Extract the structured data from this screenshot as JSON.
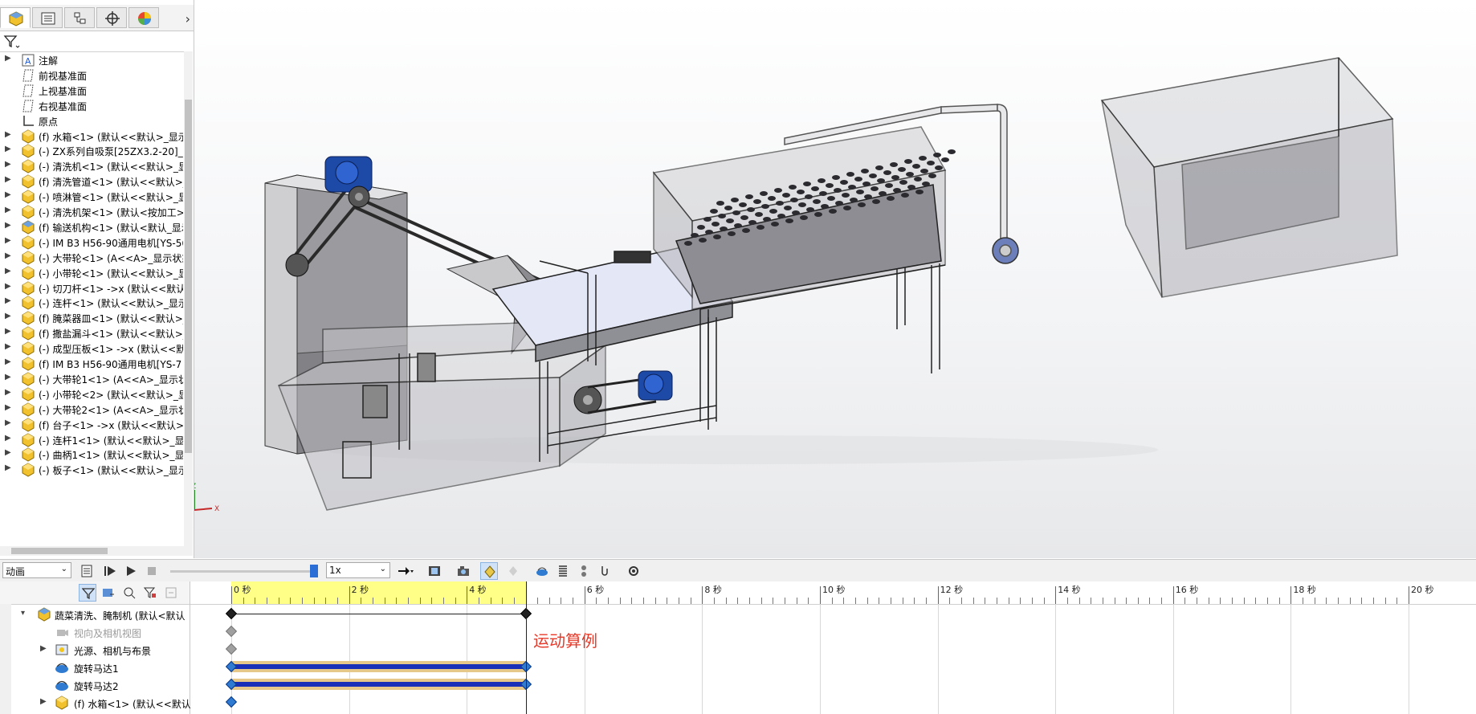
{
  "feature_tree": {
    "items": [
      {
        "label": "注解",
        "icon": "annotation-icon",
        "expandable": true
      },
      {
        "label": "前视基准面",
        "icon": "plane-icon",
        "expandable": false
      },
      {
        "label": "上视基准面",
        "icon": "plane-icon",
        "expandable": false
      },
      {
        "label": "右视基准面",
        "icon": "plane-icon",
        "expandable": false
      },
      {
        "label": "原点",
        "icon": "origin-icon",
        "expandable": false
      },
      {
        "label": "(f) 水箱<1> (默认<<默认>_显示",
        "icon": "part-icon",
        "expandable": true
      },
      {
        "label": "(-) ZX系列自吸泵[25ZX3.2-20]_自",
        "icon": "part-icon",
        "expandable": true
      },
      {
        "label": "(-) 清洗机<1> (默认<<默认>_显",
        "icon": "part-icon",
        "expandable": true
      },
      {
        "label": "(f) 清洗管道<1> (默认<<默认>_",
        "icon": "part-icon",
        "expandable": true
      },
      {
        "label": "(-) 喷淋管<1> (默认<<默认>_显",
        "icon": "part-icon",
        "expandable": true
      },
      {
        "label": "(-) 清洗机架<1> (默认<按加工>",
        "icon": "part-icon",
        "expandable": true
      },
      {
        "label": "(f) 输送机构<1> (默认<默认_显示",
        "icon": "assembly-icon",
        "expandable": true
      },
      {
        "label": "(-) IM B3 H56-90通用电机[YS-56",
        "icon": "part-icon",
        "expandable": true
      },
      {
        "label": "(-) 大带轮<1> (A<<A>_显示状态",
        "icon": "part-icon",
        "expandable": true
      },
      {
        "label": "(-) 小带轮<1> (默认<<默认>_显",
        "icon": "part-icon",
        "expandable": true
      },
      {
        "label": "(-) 切刀杆<1> ->x (默认<<默认",
        "icon": "part-icon",
        "expandable": true
      },
      {
        "label": "(-) 连杆<1> (默认<<默认>_显示",
        "icon": "part-icon",
        "expandable": true
      },
      {
        "label": "(f) 腌菜器皿<1> (默认<<默认>_",
        "icon": "part-icon",
        "expandable": true
      },
      {
        "label": "(f) 撒盐漏斗<1> (默认<<默认>_",
        "icon": "part-icon",
        "expandable": true
      },
      {
        "label": "(-) 成型压板<1> ->x (默认<<默",
        "icon": "part-icon",
        "expandable": true
      },
      {
        "label": "(f) IM B3 H56-90通用电机[YS-7",
        "icon": "part-icon",
        "expandable": true
      },
      {
        "label": "(-) 大带轮1<1> (A<<A>_显示状",
        "icon": "part-icon",
        "expandable": true
      },
      {
        "label": "(-) 小带轮<2> (默认<<默认>_显",
        "icon": "part-icon",
        "expandable": true
      },
      {
        "label": "(-) 大带轮2<1> (A<<A>_显示状",
        "icon": "part-icon",
        "expandable": true
      },
      {
        "label": "(f) 台子<1> ->x (默认<<默认>_",
        "icon": "part-icon",
        "expandable": true
      },
      {
        "label": "(-) 连杆1<1> (默认<<默认>_显示",
        "icon": "part-icon",
        "expandable": true
      },
      {
        "label": "(-) 曲柄1<1> (默认<<默认>_显示",
        "icon": "part-icon",
        "expandable": true
      },
      {
        "label": "(-) 板子<1> (默认<<默认>_显示",
        "icon": "part-icon",
        "expandable": true
      }
    ]
  },
  "motion_toolbar": {
    "study_type": "动画",
    "playback_speed": "1x"
  },
  "motion_tree": {
    "items": [
      {
        "label": "蔬菜清洗、腌制机 (默认<默认",
        "icon": "assembly-icon",
        "dim": false
      },
      {
        "label": "视向及相机视图",
        "icon": "camera-icon",
        "dim": true
      },
      {
        "label": "光源、相机与布景",
        "icon": "lights-icon",
        "dim": false
      },
      {
        "label": "旋转马达1",
        "icon": "rotary-motor-icon",
        "dim": false
      },
      {
        "label": "旋转马达2",
        "icon": "rotary-motor-icon",
        "dim": false
      },
      {
        "label": "(f) 水箱<1> (默认<<默认",
        "icon": "part-icon",
        "dim": false
      }
    ]
  },
  "timeline": {
    "tick_labels": [
      "0 秒",
      "2 秒",
      "4 秒",
      "6 秒",
      "8 秒",
      "10 秒",
      "12 秒",
      "14 秒",
      "16 秒",
      "18 秒",
      "20 秒"
    ],
    "current_time_seconds": 5,
    "annotation": "运动算例"
  },
  "colors": {
    "ruler_highlight": "#ffff88",
    "motor_track_blue": "#1a2fb8",
    "motor_track_tan": "#e6c98a",
    "annotation_red": "#e53a2a",
    "motor_blue": "#1d4aa6"
  }
}
